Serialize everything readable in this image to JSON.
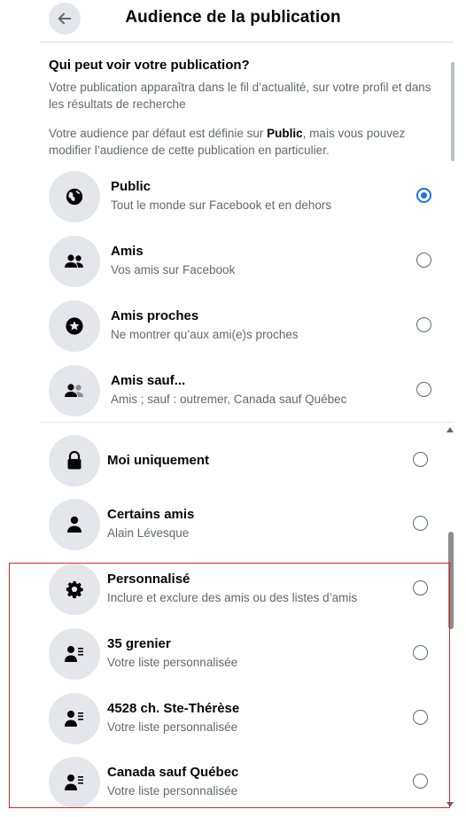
{
  "header": {
    "title": "Audience de la publication",
    "back_icon": "arrow-left-icon"
  },
  "intro": {
    "question": "Qui peut voir votre publication?",
    "description": "Votre publication apparaîtra dans le fil d’actualité, sur votre profil et dans les résultats de recherche",
    "default_prefix": "Votre audience par défaut est définie sur ",
    "default_value": "Public",
    "default_suffix": ", mais vous pouvez modifier l’audience de cette publication en particulier."
  },
  "options_top": [
    {
      "label": "Public",
      "sub": "Tout le monde sur Facebook et en dehors",
      "icon": "globe-icon",
      "selected": true
    },
    {
      "label": "Amis",
      "sub": "Vos amis sur Facebook",
      "icon": "friends-icon",
      "selected": false
    },
    {
      "label": "Amis proches",
      "sub": "Ne montrer qu’aux ami(e)s proches",
      "icon": "star-icon",
      "selected": false
    },
    {
      "label": "Amis sauf...",
      "sub": "Amis ; sauf : outremer, Canada sauf Québec",
      "icon": "friends-except-icon",
      "selected": false
    }
  ],
  "options_bottom": [
    {
      "label": "Moi uniquement",
      "sub": "",
      "icon": "lock-icon",
      "selected": false
    },
    {
      "label": "Certains amis",
      "sub": "Alain Lévesque",
      "icon": "person-icon",
      "selected": false
    },
    {
      "label": "Personnalisé",
      "sub": "Inclure et exclure des amis ou des listes d’amis",
      "icon": "gear-icon",
      "selected": false
    },
    {
      "label": "35 grenier",
      "sub": "Votre liste personnalisée",
      "icon": "person-list-icon",
      "selected": false
    },
    {
      "label": "4528 ch. Ste-Thérèse",
      "sub": "Votre liste personnalisée",
      "icon": "person-list-icon",
      "selected": false
    },
    {
      "label": "Canada sauf Québec",
      "sub": "Votre liste personnalisée",
      "icon": "person-list-icon",
      "selected": false
    }
  ],
  "colors": {
    "accent": "#1b74e4",
    "icon_bg": "#e4e6eb",
    "secondary_text": "#65676b",
    "highlight": "#e02525"
  }
}
